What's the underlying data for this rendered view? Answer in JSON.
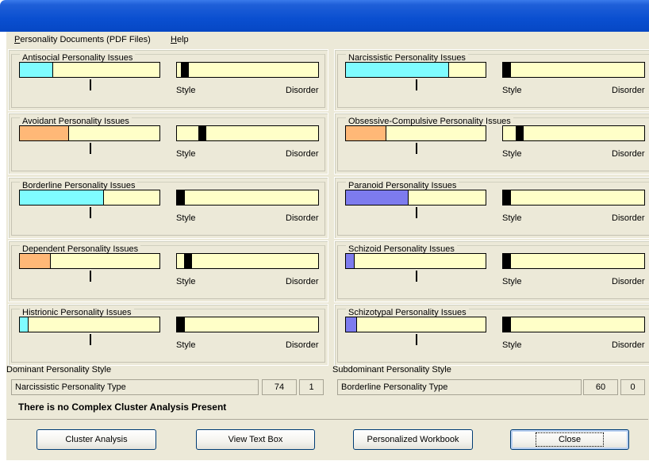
{
  "colors": {
    "bar_background": "#ffffc8",
    "cyan": "#7ffcff",
    "orange": "#ffb877",
    "purple": "#7d7bee",
    "marker": "#000000"
  },
  "menu": {
    "documents": "Personality Documents (PDF Files)",
    "help": "Help"
  },
  "scale_labels": {
    "style": "Style",
    "disorder": "Disorder"
  },
  "groups": [
    {
      "title": "Antisocial Personality Issues",
      "level": 0.24,
      "color": "cyan",
      "style_marker": 0.03
    },
    {
      "title": "Narcissistic Personality Issues",
      "level": 0.74,
      "color": "cyan",
      "style_marker": 0.0
    },
    {
      "title": "Avoidant Personality Issues",
      "level": 0.35,
      "color": "orange",
      "style_marker": 0.15
    },
    {
      "title": "Obsessive-Compulsive Personality Issues",
      "level": 0.29,
      "color": "orange",
      "style_marker": 0.09
    },
    {
      "title": "Borderline Personality Issues",
      "level": 0.6,
      "color": "cyan",
      "style_marker": 0.0
    },
    {
      "title": "Paranoid Personality Issues",
      "level": 0.45,
      "color": "purple",
      "style_marker": 0.0
    },
    {
      "title": "Dependent Personality Issues",
      "level": 0.22,
      "color": "orange",
      "style_marker": 0.05
    },
    {
      "title": "Schizoid Personality Issues",
      "level": 0.06,
      "color": "purple",
      "style_marker": 0.0
    },
    {
      "title": "Histrionic Personality Issues",
      "level": 0.06,
      "color": "cyan",
      "style_marker": 0.0
    },
    {
      "title": "Schizotypal Personality Issues",
      "level": 0.08,
      "color": "purple",
      "style_marker": 0.0
    }
  ],
  "summary": {
    "dominant_label": "Dominant Personality Style",
    "dominant_type": "Narcissistic Personality Type",
    "dominant_score": "74",
    "dominant_rank": "1",
    "subdominant_label": "Subdominant Personality Style",
    "subdominant_type": "Borderline Personality Type",
    "subdominant_score": "60",
    "subdominant_rank": "0"
  },
  "complex_message": "There is no Complex Cluster Analysis Present",
  "buttons": {
    "cluster": "Cluster Analysis",
    "view_text": "View Text Box",
    "workbook": "Personalized Workbook",
    "close": "Close"
  }
}
